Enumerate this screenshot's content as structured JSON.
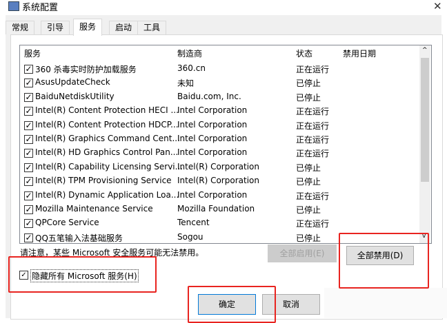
{
  "window": {
    "title": "系统配置",
    "close": "✕"
  },
  "tabs": [
    {
      "label": "常规"
    },
    {
      "label": "引导"
    },
    {
      "label": "服务",
      "active": true
    },
    {
      "label": "启动"
    },
    {
      "label": "工具"
    }
  ],
  "columns": [
    "服务",
    "制造商",
    "状态",
    "禁用日期"
  ],
  "services": [
    {
      "name": "360 杀毒实时防护加载服务",
      "maker": "360.cn",
      "status": "正在运行",
      "checked": true
    },
    {
      "name": "AsusUpdateCheck",
      "maker": "未知",
      "status": "已停止",
      "checked": true
    },
    {
      "name": "BaiduNetdiskUtility",
      "maker": "Baidu.com, Inc.",
      "status": "已停止",
      "checked": true
    },
    {
      "name": "Intel(R) Content Protection HECI ...",
      "maker": "Intel Corporation",
      "status": "正在运行",
      "checked": true
    },
    {
      "name": "Intel(R) Content Protection HDCP...",
      "maker": "Intel Corporation",
      "status": "正在运行",
      "checked": true
    },
    {
      "name": "Intel(R) Graphics Command Cent...",
      "maker": "Intel Corporation",
      "status": "正在运行",
      "checked": true
    },
    {
      "name": "Intel(R) HD Graphics Control Pan...",
      "maker": "Intel Corporation",
      "status": "正在运行",
      "checked": true
    },
    {
      "name": "Intel(R) Capability Licensing Servi...",
      "maker": "Intel(R) Corporation",
      "status": "已停止",
      "checked": true
    },
    {
      "name": "Intel(R) TPM Provisioning Service",
      "maker": "Intel(R) Corporation",
      "status": "已停止",
      "checked": true
    },
    {
      "name": "Intel(R) Dynamic Application Loa...",
      "maker": "Intel Corporation",
      "status": "正在运行",
      "checked": true
    },
    {
      "name": "Mozilla Maintenance Service",
      "maker": "Mozilla Foundation",
      "status": "已停止",
      "checked": true
    },
    {
      "name": "QPCore Service",
      "maker": "Tencent",
      "status": "正在运行",
      "checked": true
    },
    {
      "name": "QQ五笔输入法基础服务",
      "maker": "Sogou",
      "status": "已停止",
      "checked": true
    }
  ],
  "note": "请注意，某些 Microsoft 安全服务可能无法禁用。",
  "buttons": {
    "enable_all": "全部启用(E)",
    "disable_all": "全部禁用(D)",
    "ok": "确定",
    "cancel": "取消"
  },
  "hide_ms": {
    "label": "隐藏所有 Microsoft 服务(H)",
    "checked": true
  },
  "highlight_color": "#e8231f"
}
